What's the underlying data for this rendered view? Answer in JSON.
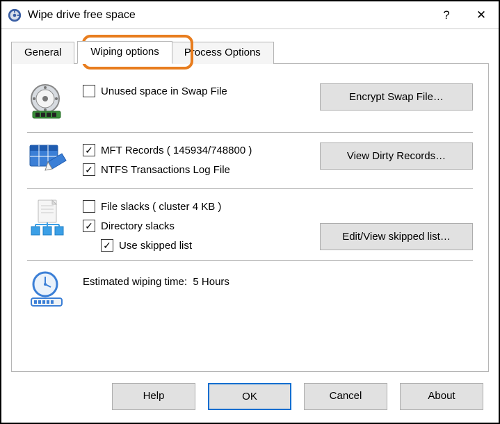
{
  "window": {
    "title": "Wipe drive free space",
    "help_glyph": "?",
    "close_glyph": "✕"
  },
  "tabs": {
    "general": "General",
    "wiping": "Wiping options",
    "process": "Process Options"
  },
  "swap": {
    "unused_label": "Unused space in Swap File",
    "encrypt_btn": "Encrypt Swap File…"
  },
  "mft": {
    "records_label": "MFT Records ( 145934/748800 )",
    "ntfs_label": "NTFS Transactions Log File",
    "view_btn": "View Dirty Records…"
  },
  "slacks": {
    "file_label": "File slacks ( cluster 4 KB )",
    "dir_label": "Directory slacks",
    "skip_label": "Use skipped list",
    "edit_btn": "Edit/View skipped list…"
  },
  "estimate": {
    "label": "Estimated wiping time:",
    "value": "5 Hours"
  },
  "buttons": {
    "help": "Help",
    "ok": "OK",
    "cancel": "Cancel",
    "about": "About"
  }
}
